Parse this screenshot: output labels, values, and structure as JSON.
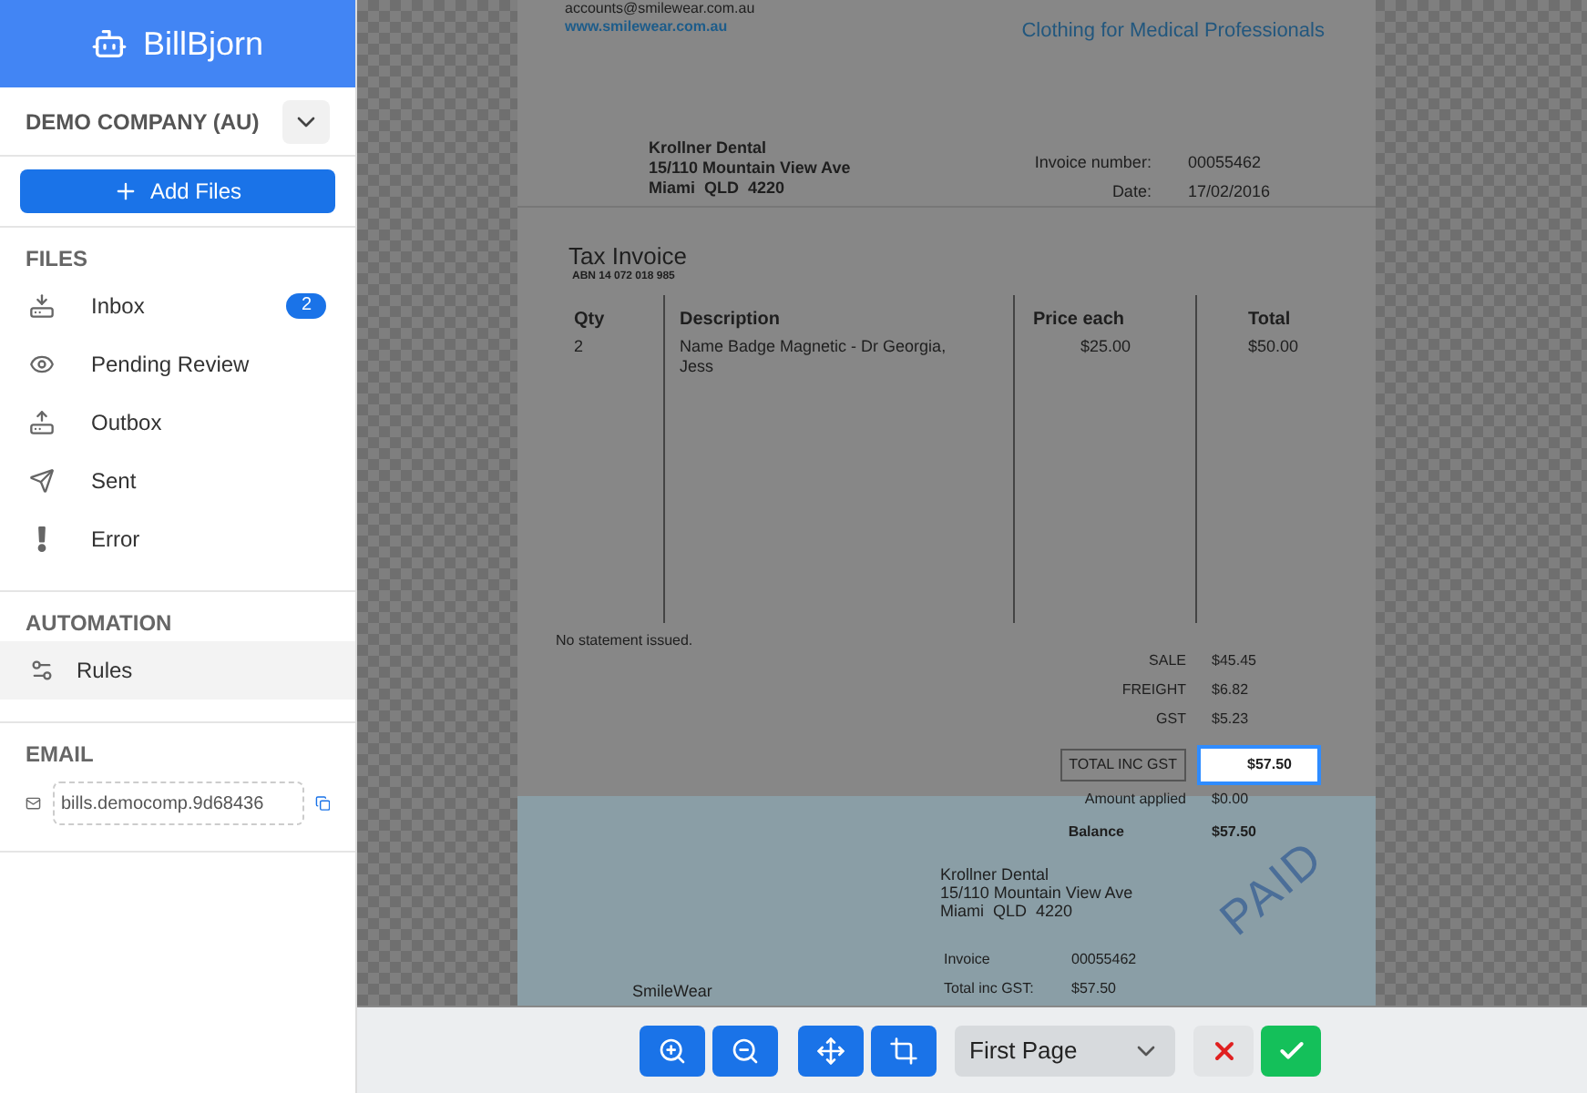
{
  "app": {
    "name": "BillBjorn"
  },
  "company": {
    "name": "DEMO COMPANY (AU)"
  },
  "add_button": {
    "label": "Add Files"
  },
  "sections": [
    {
      "title": "FILES",
      "items": [
        {
          "label": "Inbox",
          "badge": "2",
          "selected": false
        },
        {
          "label": "Pending Review",
          "selected": false
        },
        {
          "label": "Outbox",
          "selected": false
        },
        {
          "label": "Sent",
          "selected": false
        },
        {
          "label": "Error",
          "selected": false
        }
      ]
    },
    {
      "title": "AUTOMATION",
      "items": [
        {
          "label": "Rules",
          "selected": true
        }
      ]
    }
  ],
  "email": {
    "title": "EMAIL",
    "value": "bills.democomp.9d68436"
  },
  "document": {
    "sender_email": "accounts@smilewear.com.au",
    "sender_website": "www.smilewear.com.au",
    "tagline": "Clothing for Medical Professionals",
    "bill_to": [
      "Krollner Dental",
      "15/110 Mountain View Ave",
      "Miami  QLD  4220"
    ],
    "meta": [
      {
        "label": "Invoice number:",
        "value": "00055462"
      },
      {
        "label": "Date:",
        "value": "17/02/2016"
      }
    ],
    "title": "Tax Invoice",
    "abn": "ABN 14 072 018 985",
    "columns": [
      "Qty",
      "Description",
      "Price each",
      "Total"
    ],
    "rows": [
      [
        "2",
        "Name Badge Magnetic - Dr Georgia, Jess",
        "$25.00",
        "$50.00"
      ]
    ],
    "note": "No statement issued.",
    "totals": [
      {
        "kind": "plain",
        "label": "SALE",
        "value": "$45.45",
        "selected": false
      },
      {
        "kind": "plain",
        "label": "FREIGHT",
        "value": "$6.82",
        "selected": false
      },
      {
        "kind": "plain",
        "label": "GST",
        "value": "$5.23",
        "selected": false
      },
      {
        "kind": "boxed",
        "label": "TOTAL INC GST",
        "value": "$57.50",
        "selected": true
      },
      {
        "kind": "plain",
        "label": "Amount applied",
        "value": "$0.00",
        "selected": false
      },
      {
        "kind": "bold",
        "label": "Balance",
        "value": "$57.50",
        "selected": false
      }
    ],
    "slip": {
      "address": [
        "Krollner Dental",
        "15/110 Mountain View Ave",
        "Miami  QLD  4220"
      ],
      "stamp": "PAID",
      "details": [
        {
          "label": "Invoice",
          "value": "00055462"
        },
        {
          "label": "Total inc GST:",
          "value": "$57.50"
        }
      ],
      "sender": "SmileWear"
    }
  },
  "toolbar": {
    "page_select": "First Page"
  }
}
